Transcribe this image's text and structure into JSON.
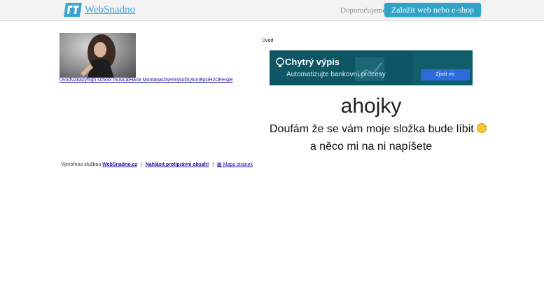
{
  "topbar": {
    "logo_text": "WebSnadno",
    "recommend_label": "Doporučujeme",
    "cta_label": "Založit web nebo e-shop"
  },
  "nav": {
    "links": [
      "Uvod",
      "Vzkazy",
      "high school musical",
      "Hana Montana",
      "Olsenky",
      "kočky",
      "koně",
      "psi",
      "H2O",
      "Fergie"
    ]
  },
  "footer": {
    "created_by": "Vytvořeno službou",
    "service_link": "WebSnadno.cz",
    "report_link": "Nahlásit protiprávní obsah!",
    "sitemap_link": "Mapa stránek"
  },
  "content": {
    "section_title": "Úvod",
    "heading": "ahojky",
    "line1": "Doufám že se vám moje složka bude líbit",
    "line2": "a něco mi na ni napíšete"
  },
  "ad": {
    "title": "Chytrý výpis",
    "subtitle": "Automatizujte bankovní procesy",
    "button": "Zjistit víc"
  },
  "colors": {
    "accent": "#2fa3c8",
    "logo": "#3aa6d6",
    "ad_background": "#0f5665",
    "ad_button": "#2c6bdc",
    "link": "#1a0dab"
  }
}
